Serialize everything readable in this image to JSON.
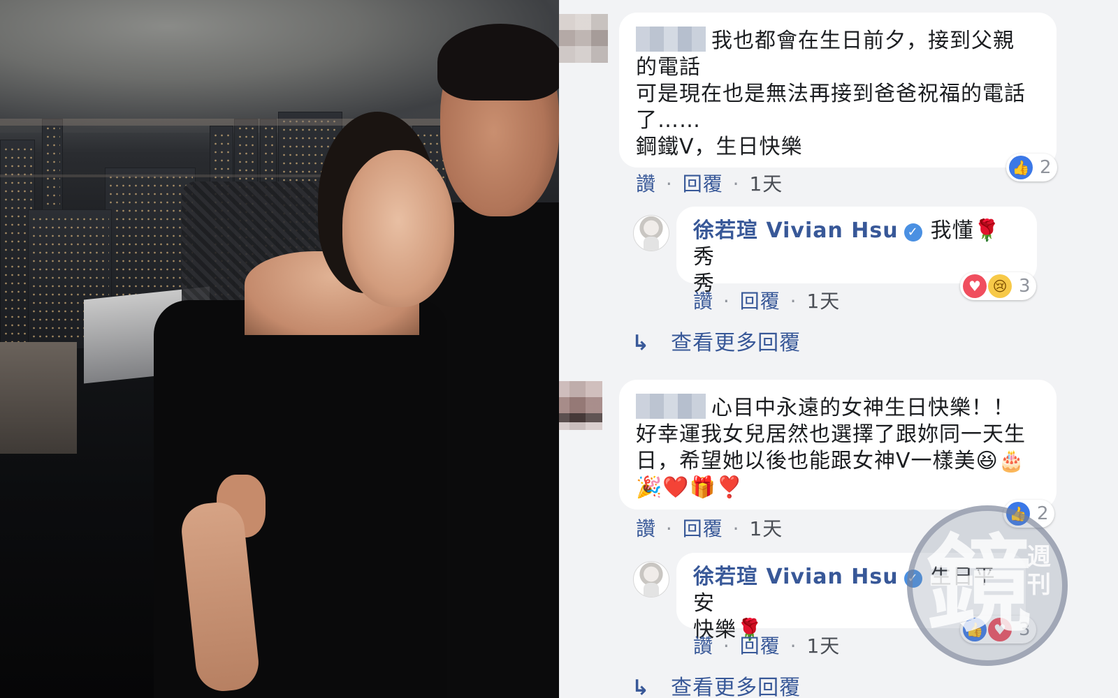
{
  "comments": [
    {
      "lines": [
        "我也都會在生日前夕，接到父親",
        "的電話",
        "可是現在也是無法再接到爸爸祝福的電話",
        "了……",
        "鋼鐵V，生日快樂"
      ],
      "meta": {
        "like": "讚",
        "reply": "回覆",
        "time": "1天"
      },
      "reaction_count": "2",
      "reply": {
        "author": "徐若瑄 Vivian Hsu",
        "text_1": "我懂",
        "emoji_1": "🌹",
        "text_2": "秀",
        "line2": "秀",
        "meta": {
          "like": "讚",
          "reply": "回覆",
          "time": "1天"
        },
        "reaction_count": "3"
      },
      "more_replies": "查看更多回覆"
    },
    {
      "lines": [
        "心目中永遠的女神生日快樂！！",
        "好幸運我女兒居然也選擇了跟妳同一天生",
        "日，希望她以後也能跟女神V一樣美"
      ],
      "emoji_line1_end": "😆🎂",
      "emoji_line2": "🎉❤️🎁❣️",
      "meta": {
        "like": "讚",
        "reply": "回覆",
        "time": "1天"
      },
      "reaction_count": "2",
      "reply": {
        "author": "徐若瑄 Vivian Hsu",
        "text_1": "生日平安",
        "line2": "快樂",
        "emoji_2": "🌹",
        "meta": {
          "like": "讚",
          "reply": "回覆",
          "time": "1天"
        },
        "reaction_count": "3"
      },
      "more_replies": "查看更多回覆"
    }
  ],
  "watermark": {
    "big": "鏡",
    "small": "週刊"
  },
  "icons": {
    "verified": "verified-badge-icon",
    "like": "thumbs-up-icon",
    "love": "heart-icon",
    "sad": "sad-face-icon",
    "reply_arrow": "reply-arrow-icon"
  },
  "colors": {
    "link": "#385898",
    "feed_bg": "#f2f3f5",
    "like": "#3b78e7",
    "love": "#f04e5e"
  }
}
